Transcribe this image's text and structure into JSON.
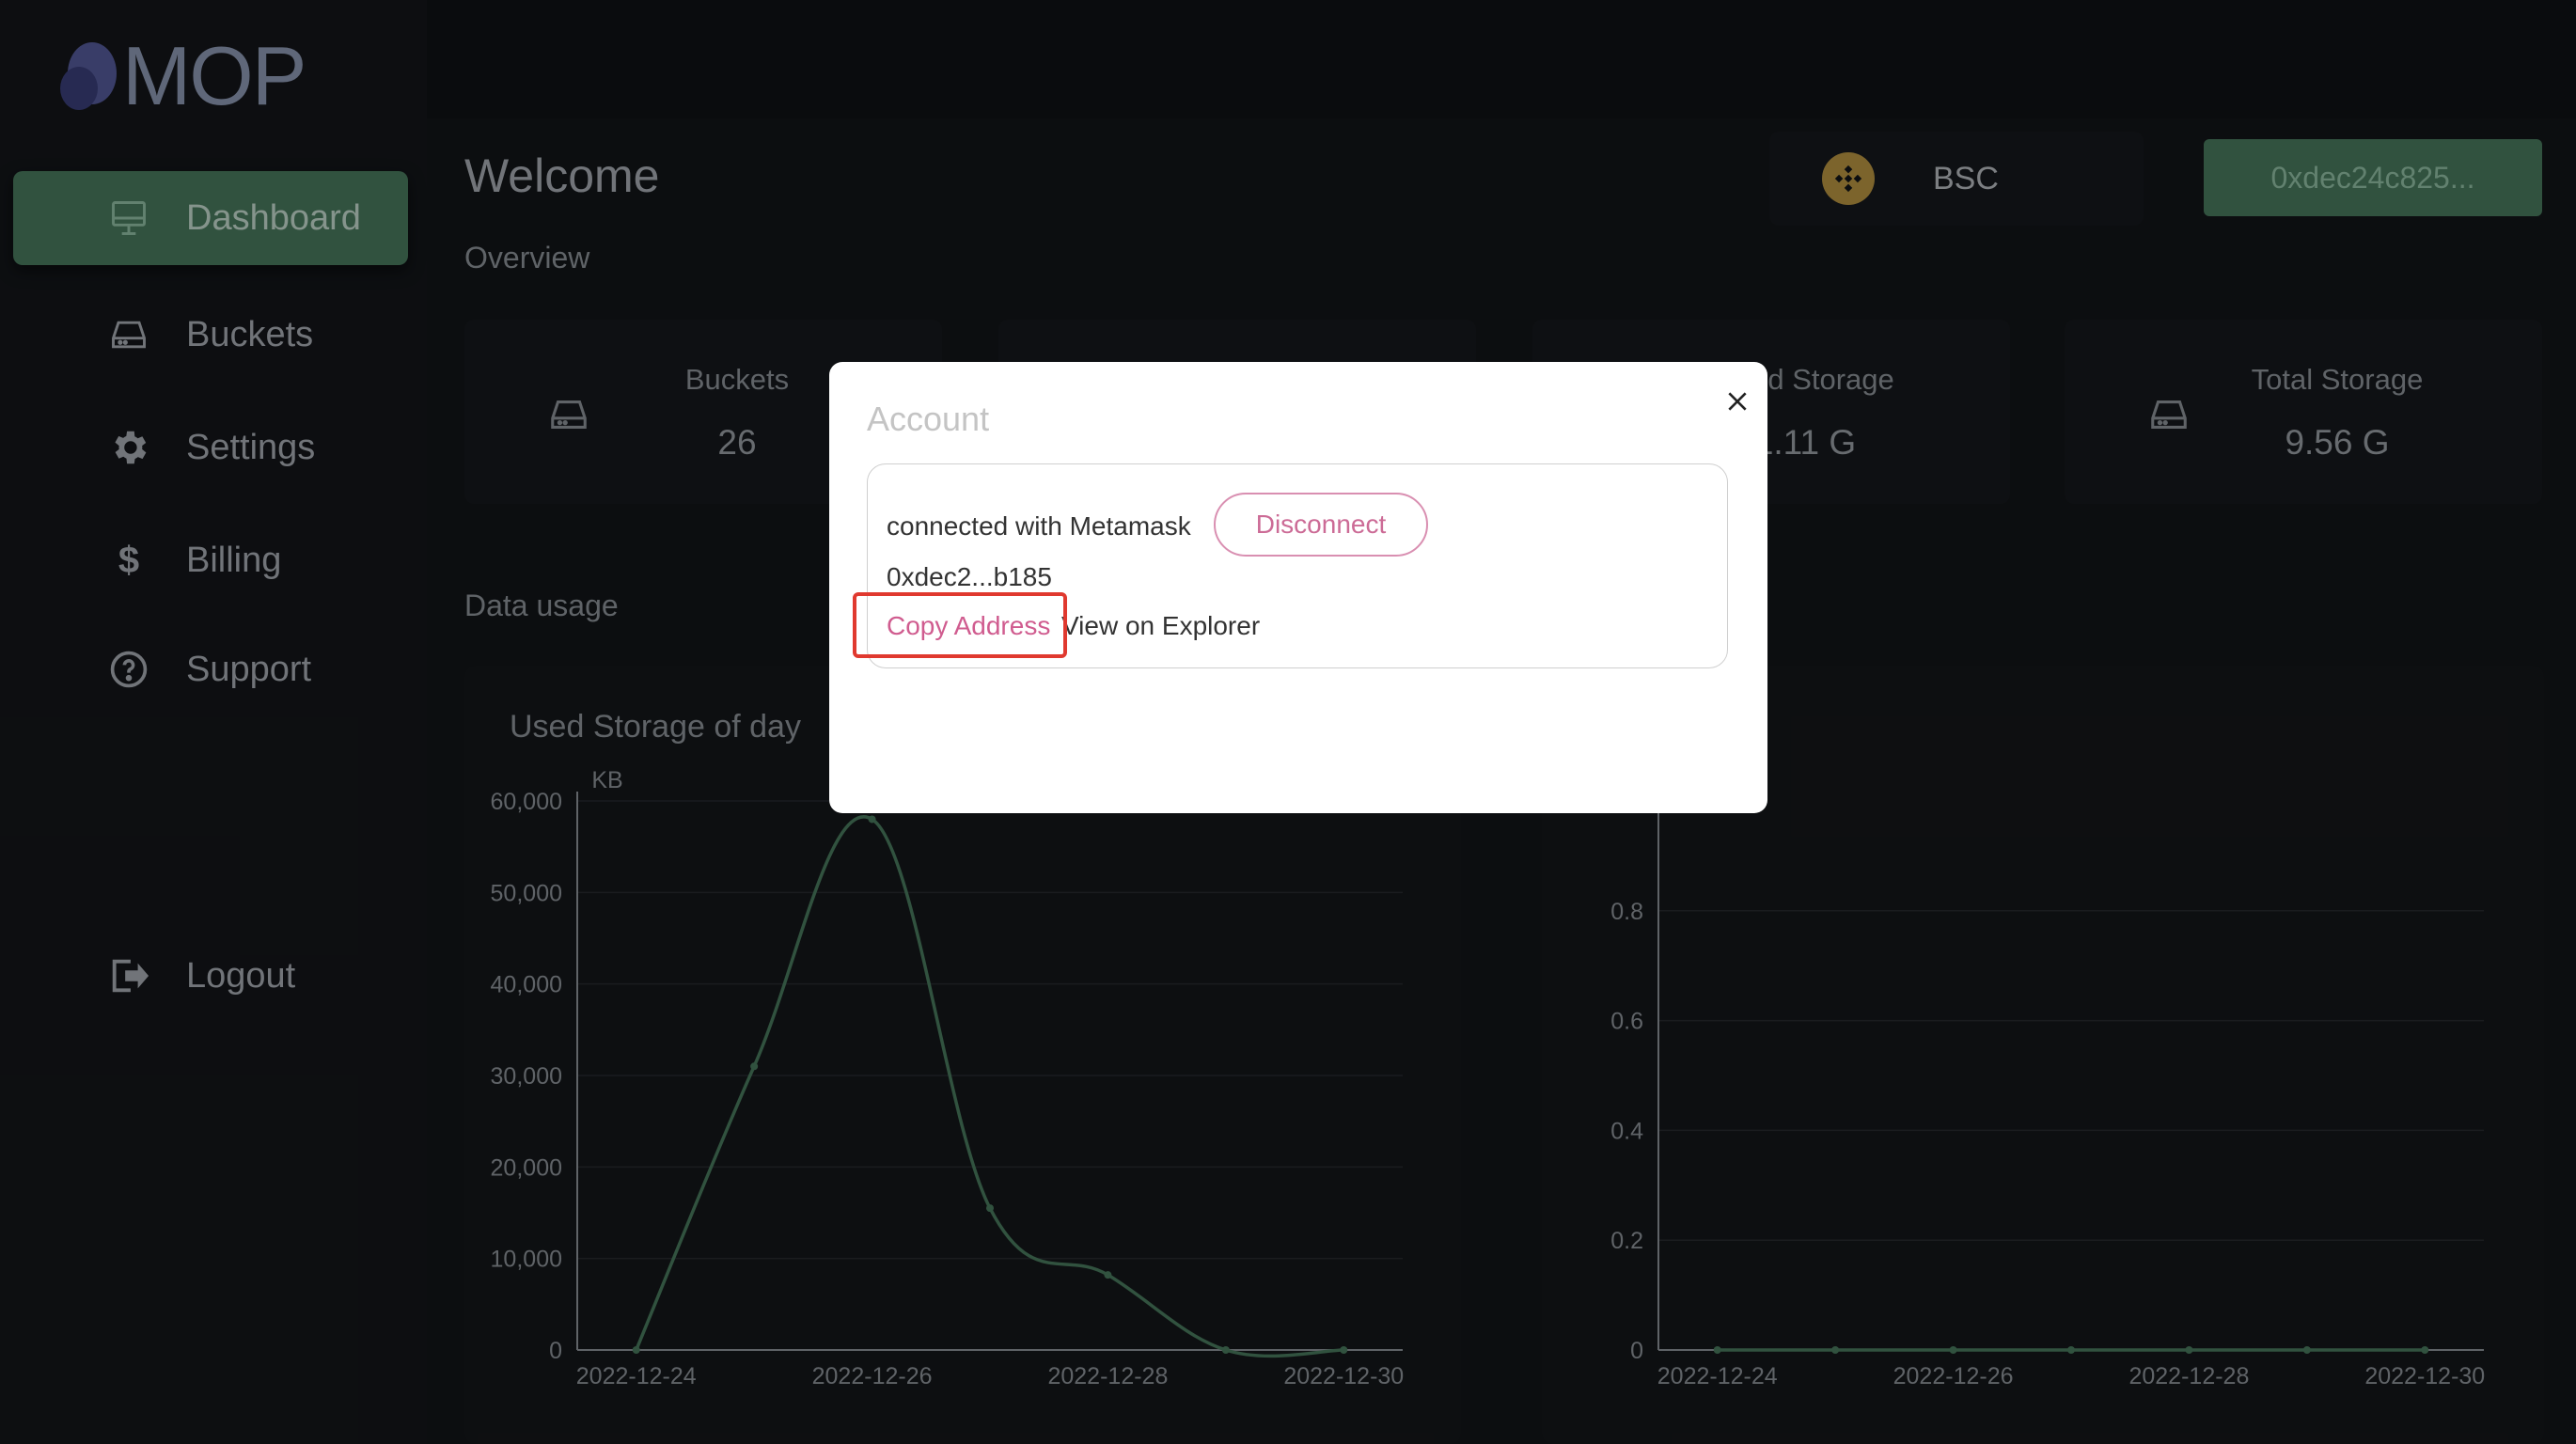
{
  "app": {
    "logo_text": "MOP"
  },
  "sidebar": {
    "items": [
      {
        "label": "Dashboard",
        "icon": "monitor-icon",
        "active": true
      },
      {
        "label": "Buckets",
        "icon": "drive-icon"
      },
      {
        "label": "Settings",
        "icon": "gear-icon"
      },
      {
        "label": "Billing",
        "icon": "dollar-icon"
      },
      {
        "label": "Support",
        "icon": "help-circle-icon"
      }
    ],
    "logout": {
      "label": "Logout",
      "icon": "logout-icon"
    }
  },
  "header": {
    "welcome": "Welcome",
    "network": {
      "label": "BSC",
      "icon": "bnb-icon",
      "color": "#c9a248"
    },
    "address_button": "0xdec24c825..."
  },
  "overview": {
    "title": "Overview",
    "stats": [
      {
        "title": "Buckets",
        "value": "26"
      },
      {
        "title": "",
        "value": ""
      },
      {
        "title": "Used Storage",
        "value": "1.11 G"
      },
      {
        "title": "Total Storage",
        "value": "9.56 G"
      }
    ]
  },
  "data_usage": {
    "title": "Data usage"
  },
  "chart_data": [
    {
      "type": "line",
      "title": "Used Storage of day",
      "ylabel": "KB",
      "x": [
        "2022-12-24",
        "2022-12-25",
        "2022-12-26",
        "2022-12-27",
        "2022-12-28",
        "2022-12-29",
        "2022-12-30"
      ],
      "values": [
        0,
        31000,
        58000,
        15500,
        8200,
        0,
        0
      ],
      "ylim": [
        0,
        60000
      ],
      "yticks": [
        "0",
        "10,000",
        "20,000",
        "30,000",
        "40,000",
        "50,000",
        "60,000"
      ],
      "xticks": [
        "2022-12-24",
        "2022-12-26",
        "2022-12-28",
        "2022-12-30"
      ],
      "color": "#4f8566",
      "grid": true
    },
    {
      "type": "line",
      "title": "",
      "x": [
        "2022-12-24",
        "2022-12-25",
        "2022-12-26",
        "2022-12-27",
        "2022-12-28",
        "2022-12-29",
        "2022-12-30"
      ],
      "values": [
        0,
        0,
        0,
        0,
        0,
        0,
        0
      ],
      "ylim": [
        0,
        1
      ],
      "yticks": [
        "0",
        "0.2",
        "0.4",
        "0.6",
        "0.8"
      ],
      "xticks": [
        "2022-12-24",
        "2022-12-26",
        "2022-12-28",
        "2022-12-30"
      ],
      "color": "#4f8566",
      "grid": true
    }
  ],
  "modal": {
    "title": "Account",
    "connected_text": "connected with Metamask",
    "disconnect_label": "Disconnect",
    "short_address": "0xdec2...b185",
    "copy_label": "Copy Address",
    "explorer_label": "View on Explorer",
    "accent_color": "#d05c8f"
  }
}
